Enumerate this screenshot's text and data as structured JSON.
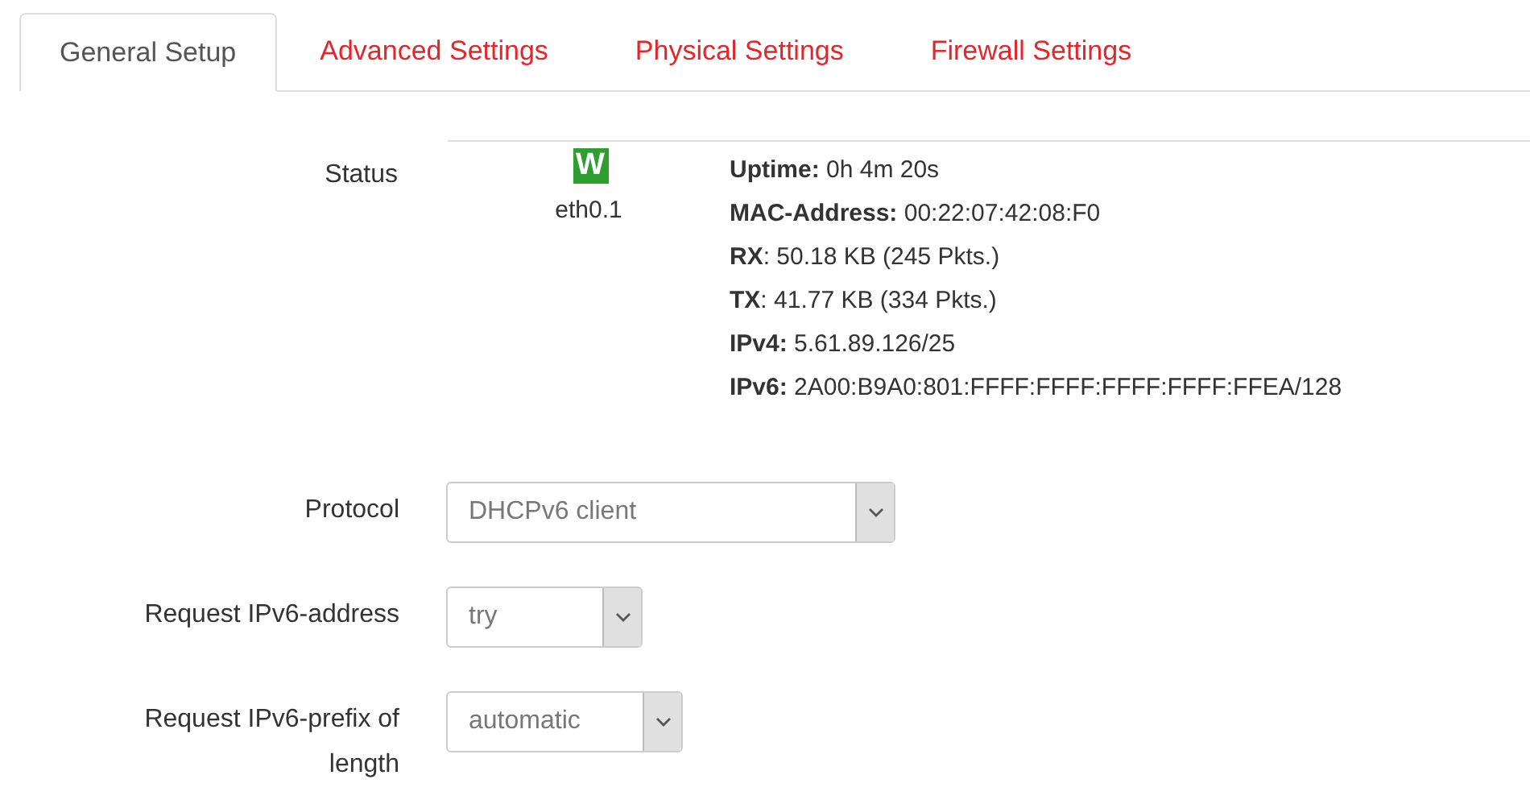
{
  "tabs": [
    {
      "label": "General Setup",
      "selected": true
    },
    {
      "label": "Advanced Settings",
      "selected": false
    },
    {
      "label": "Physical Settings",
      "selected": false
    },
    {
      "label": "Firewall Settings",
      "selected": false
    }
  ],
  "status": {
    "label": "Status",
    "device_icon": "W",
    "device": "eth0.1",
    "lines": [
      "**Uptime:** 0h 4m 20s",
      "**MAC-Address:** 00:22:07:42:08:F0",
      "**RX**: 50.18 KB (245 Pkts.)",
      "**TX**: 41.77 KB (334 Pkts.)",
      "**IPv4:** 5.61.89.126/25",
      "**IPv6:** 2A00:B9A0:801:FFFF:FFFF:FFFF:FFFF:FFEA/128"
    ]
  },
  "fields": [
    {
      "label": "Protocol",
      "value": "DHCPv6 client"
    },
    {
      "label": "Request IPv6-address",
      "value": "try"
    },
    {
      "label": "Request IPv6-prefix of length",
      "value": "automatic"
    }
  ]
}
